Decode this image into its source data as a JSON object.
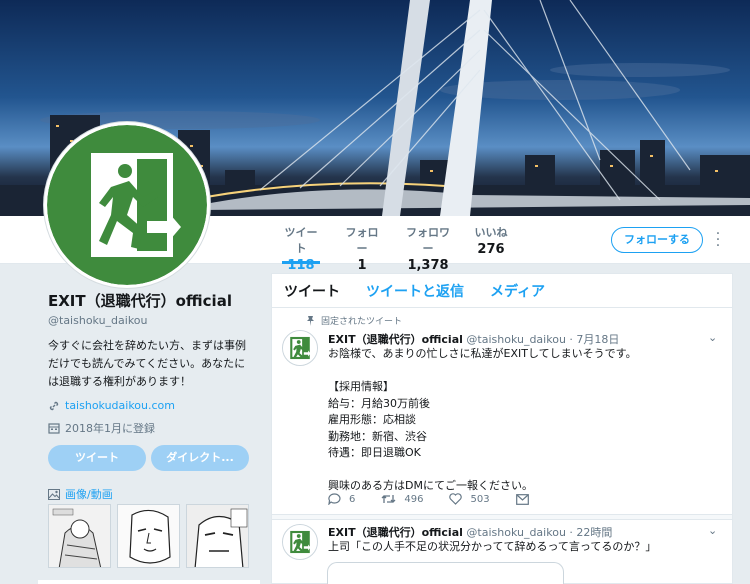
{
  "profile": {
    "name": "EXIT（退職代行）official",
    "handle": "@taishoku_daikou",
    "bio": "今すぐに会社を辞めたい方、まずは事例だけでも読んでみてください。あなたには退職する権利があります！",
    "website": "taishokudaikou.com",
    "joined": "2018年1月に登録",
    "tweet_button": "ツイート",
    "dm_button": "ダイレクト...",
    "media_label": "画像/動画"
  },
  "stats": [
    {
      "label": "ツイート",
      "value": "118"
    },
    {
      "label": "フォロー",
      "value": "1"
    },
    {
      "label": "フォロワー",
      "value": "1,378"
    },
    {
      "label": "いいね",
      "value": "276"
    }
  ],
  "follow_button": "フォローする",
  "tabs": [
    "ツイート",
    "ツイートと返信",
    "メディア"
  ],
  "pinned_label": "固定されたツイート",
  "tweets": [
    {
      "name": "EXIT（退職代行）official",
      "handle": "@taishoku_daikou",
      "time": "· 7月18日",
      "text": "お陰様で、あまりの忙しさに私達がEXITしてしまいそうです。\n\n【採用情報】\n給与：月給30万前後\n雇用形態：応相談\n勤務地：新宿、渋谷\n待遇：即日退職OK\n\n興味のある方はDMにてご一報ください。",
      "replies": "6",
      "retweets": "496",
      "likes": "503"
    },
    {
      "name": "EXIT（退職代行）official",
      "handle": "@taishoku_daikou",
      "time": "· 22時間",
      "text": "上司「この人手不足の状況分かってて辞めるって言ってるのか？」"
    }
  ],
  "colors": {
    "accent": "#1da1f2",
    "exit_green": "#3f8b3d",
    "muted": "#657786"
  }
}
